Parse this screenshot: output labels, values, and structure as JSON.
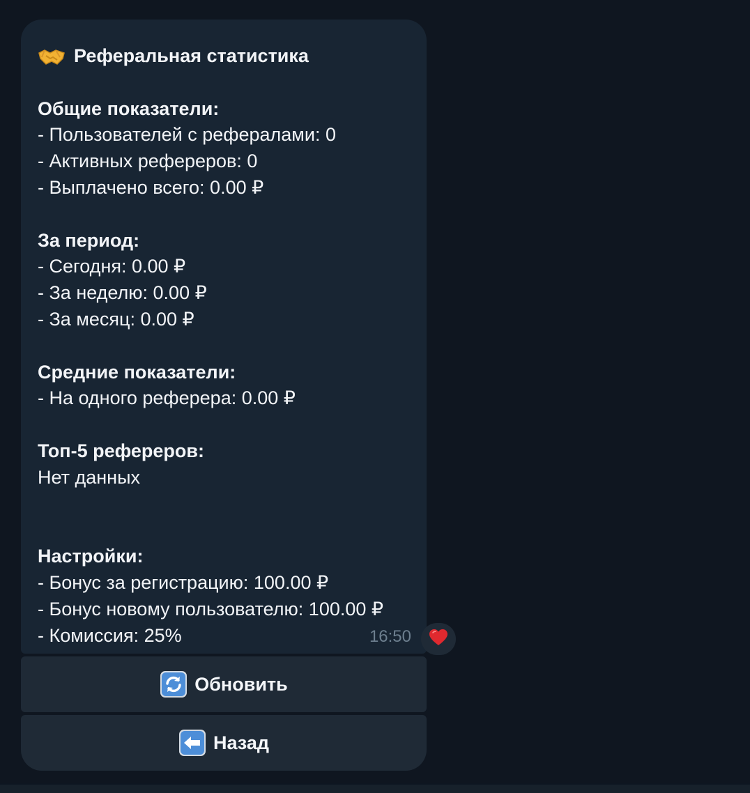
{
  "message": {
    "title": "Реферальная статистика",
    "title_icon": "handshake-icon",
    "sections": [
      {
        "heading": "Общие показатели:",
        "lines": [
          "- Пользователей с рефералами: 0",
          "- Активных рефереров: 0",
          "- Выплачено всего: 0.00 ₽"
        ]
      },
      {
        "heading": "За период:",
        "lines": [
          "- Сегодня: 0.00 ₽",
          "- За неделю: 0.00 ₽",
          "- За месяц: 0.00 ₽"
        ]
      },
      {
        "heading": "Средние показатели:",
        "lines": [
          "- На одного реферера: 0.00 ₽"
        ]
      },
      {
        "heading": "Топ-5 рефереров:",
        "lines": [
          "Нет данных"
        ]
      },
      {
        "heading": "Настройки:",
        "lines": [
          "- Бонус за регистрацию: 100.00 ₽",
          "- Бонус новому пользователю: 100.00 ₽",
          "- Комиссия: 25%"
        ]
      }
    ],
    "time": "16:50",
    "reaction_icon": "heart-icon"
  },
  "keyboard": {
    "refresh_label": "Обновить",
    "refresh_icon": "refresh-icon",
    "back_label": "Назад",
    "back_icon": "back-arrow-icon"
  },
  "colors": {
    "background": "#0e1621",
    "bubble": "#182533",
    "button": "#1f2a36",
    "time": "#6d7f8f",
    "heart": "#e0292f"
  }
}
